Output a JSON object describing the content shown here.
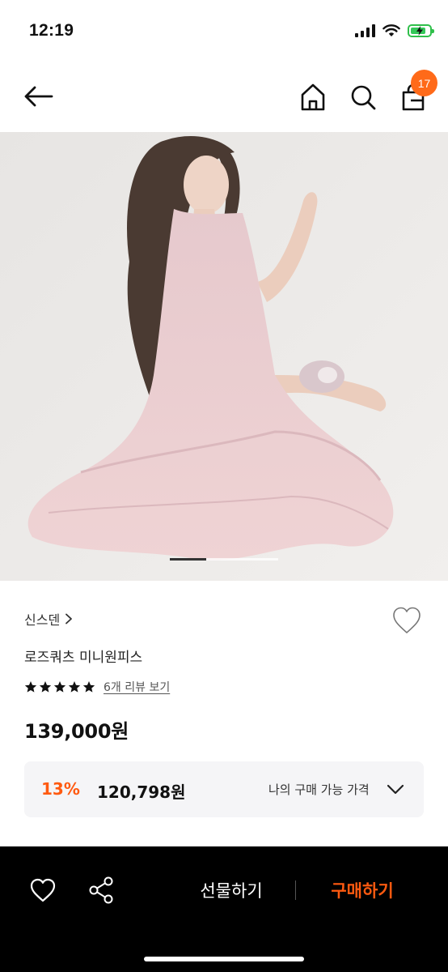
{
  "status_bar": {
    "time": "12:19"
  },
  "header": {
    "cart_count": "17"
  },
  "hero": {
    "image_index": 1,
    "image_count": 3
  },
  "product": {
    "brand": "신스덴",
    "name": "로즈쿼츠 미니원피스",
    "rating_stars": 5,
    "review_link": "6개 리뷰 보기",
    "price": "139,000원",
    "discount": {
      "rate": "13%",
      "price": "120,798원",
      "label": "나의 구매 가능 가격"
    }
  },
  "bottom_bar": {
    "gift_label": "선물하기",
    "buy_label": "구매하기"
  },
  "colors": {
    "accent": "#ff5a10",
    "badge": "#ff6a19",
    "bottom_bar": "#000000"
  },
  "icons": [
    "back-arrow-icon",
    "home-icon",
    "search-icon",
    "cart-icon",
    "heart-icon",
    "share-icon",
    "chevron-right-icon",
    "chevron-down-icon",
    "star-icon"
  ]
}
